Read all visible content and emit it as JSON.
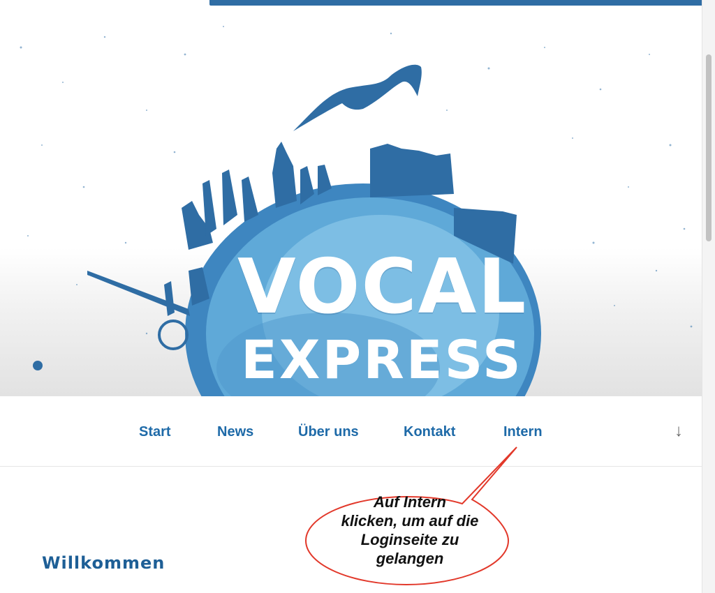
{
  "hero": {
    "logo_line1": "VOCAL",
    "logo_line2": "EXPRESS",
    "colors": {
      "primary": "#2f6da4",
      "light": "#7cc0e3",
      "bg": "#ffffff"
    },
    "graphic": "hamburg-skyline-globe-with-seagull"
  },
  "nav": {
    "items": [
      {
        "label": "Start"
      },
      {
        "label": "News"
      },
      {
        "label": "Über uns"
      },
      {
        "label": "Kontakt"
      },
      {
        "label": "Intern"
      }
    ],
    "scroll_icon": "arrow-down-icon",
    "scroll_glyph": "↓",
    "color": "#1e6aa8"
  },
  "content": {
    "heading": "Willkommen"
  },
  "callout": {
    "lines": [
      "Auf Intern",
      "klicken, um auf die",
      "Loginseite zu",
      "gelangen"
    ],
    "border_color": "#e2382a"
  }
}
